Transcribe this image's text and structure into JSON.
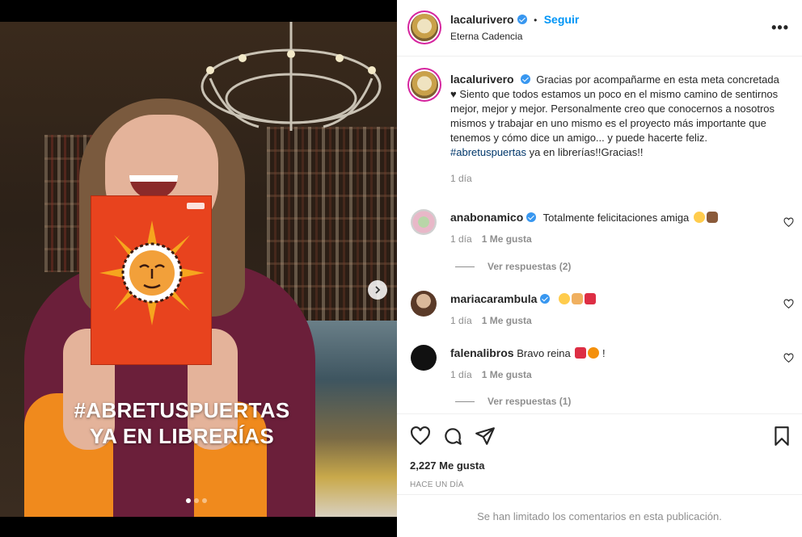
{
  "media": {
    "overlay_line1": "#ABRETUSPUERTAS",
    "overlay_line2": "YA EN LIBRERÍAS",
    "carousel_count": 3,
    "carousel_active": 1
  },
  "header": {
    "username": "lacalurivero",
    "follow_sep": "•",
    "follow_label": "Seguir",
    "location": "Eterna Cadencia",
    "more_label": "•••"
  },
  "caption": {
    "username": "lacalurivero",
    "text_part1": "Gracias por acompañarme en esta meta concretada ♥ Siento que todos estamos un poco en el mismo camino de sentirnos mejor, mejor y mejor. Personalmente creo que conocernos a nosotros mismos y trabajar en uno mismo es el proyecto más importante que tenemos y cómo dice un amigo... y puede hacerte feliz.",
    "hashtag": "#abretuspuertas",
    "text_part2": "ya en librerías!!Gracias!!",
    "time": "1 día"
  },
  "comments": [
    {
      "username": "anabonamico",
      "verified": true,
      "text": "Totalmente felicitaciones amiga",
      "time": "1 día",
      "likes": "1 Me gusta",
      "replies": "Ver respuestas (2)"
    },
    {
      "username": "mariacarambula",
      "verified": true,
      "text": "",
      "time": "1 día",
      "likes": "1 Me gusta",
      "replies": ""
    },
    {
      "username": "falenalibros",
      "verified": false,
      "text": "Bravo reina",
      "text_suffix": "!",
      "time": "1 día",
      "likes": "1 Me gusta",
      "replies": "Ver respuestas (1)"
    }
  ],
  "actions": {
    "likes": "2,227 Me gusta",
    "time": "HACE UN DÍA"
  },
  "footer": {
    "limited": "Se han limitado los comentarios en esta publicación."
  },
  "colors": {
    "accent": "#0095f6",
    "verified": "#3897f0",
    "muted": "#8e8e8e",
    "hashtag": "#00376b"
  }
}
